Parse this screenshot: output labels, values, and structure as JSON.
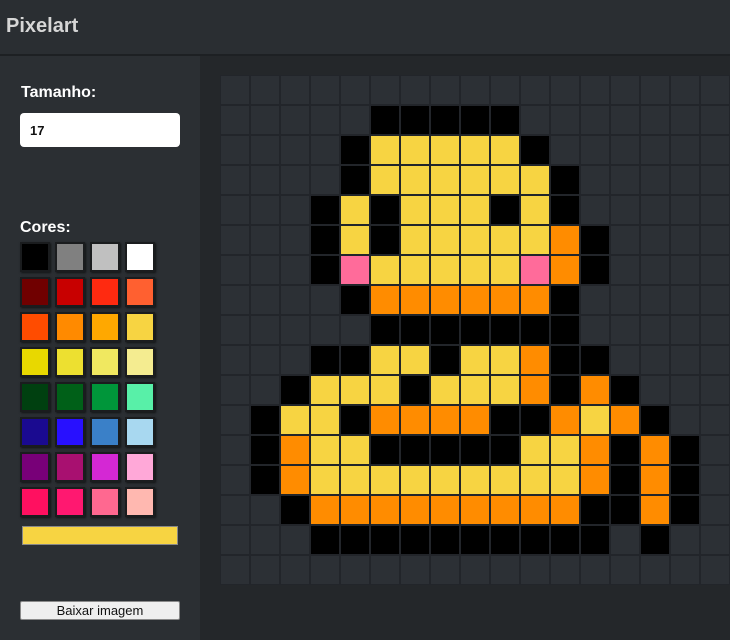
{
  "header": {
    "title": "Pixelart"
  },
  "sidebar": {
    "size_label": "Tamanho:",
    "size_value": "17",
    "colors_label": "Cores:",
    "selected_color": "#f7d442",
    "download_label": "Baixar imagem"
  },
  "palette": [
    "#000000",
    "#808080",
    "#c0c0c0",
    "#ffffff",
    "#700000",
    "#c80000",
    "#ff2a10",
    "#ff6030",
    "#ff4c00",
    "#ff8a00",
    "#ffa800",
    "#f7d442",
    "#e8d800",
    "#ede030",
    "#f0e860",
    "#f4ec90",
    "#004010",
    "#006018",
    "#00963a",
    "#58f0a8",
    "#1a0a90",
    "#2810ff",
    "#3a80c8",
    "#a8d8f0",
    "#780078",
    "#a81070",
    "#d428d4",
    "#ffa8d8",
    "#ff1060",
    "#ff1870",
    "#ff6890",
    "#ffb8b0"
  ],
  "pixel_colors": {
    "0": "#2c3035",
    "1": "#000000",
    "2": "#f7d442",
    "3": "#ff8c00",
    "4": "#ff6b9a"
  },
  "pixels": [
    "00000000000000000",
    "00000111110000000",
    "00001222221000000",
    "00001222222100000",
    "00012122212100000",
    "00012122222310000",
    "00014222224310000",
    "00001333333100000",
    "00000111111100000",
    "00011221223110000",
    "00122212223131000",
    "01221333311323100",
    "01322111112231310",
    "01322222222231310",
    "00133333333311310",
    "00011111111110100",
    "00000000000000000"
  ]
}
